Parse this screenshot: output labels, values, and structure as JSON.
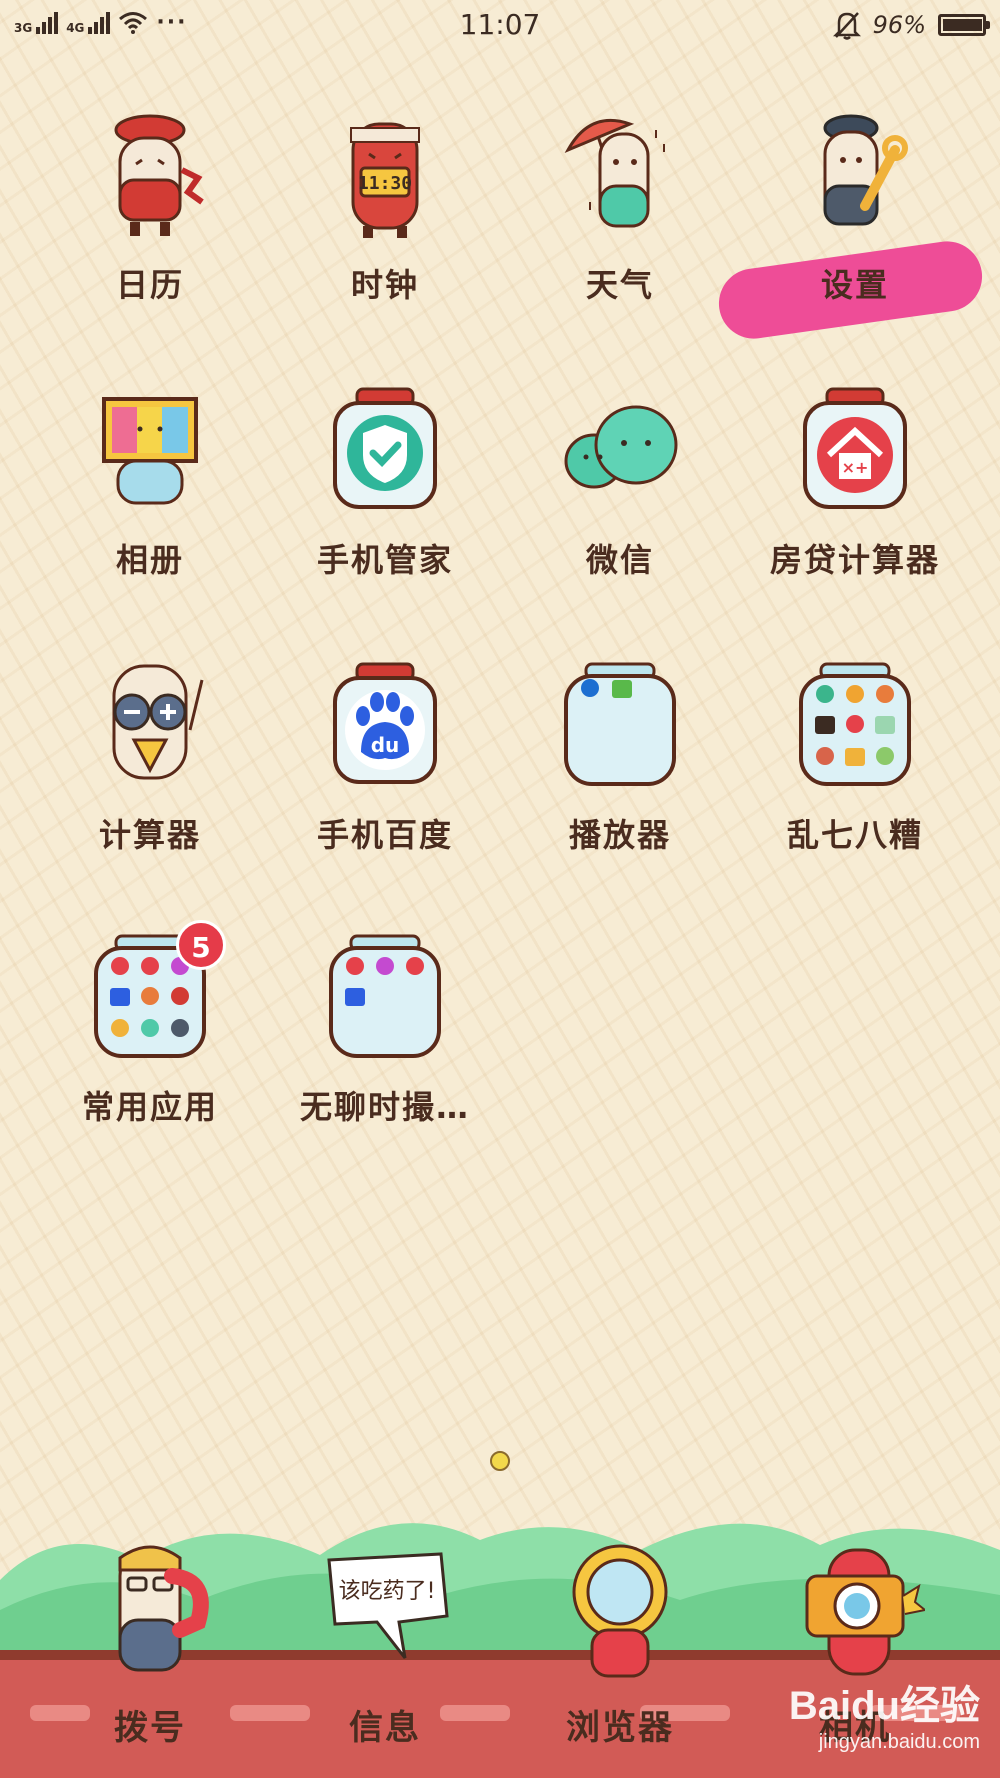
{
  "status_bar": {
    "network_1": "3G",
    "network_2": "4G",
    "time": "11:07",
    "battery_percent": "96%",
    "more": "···",
    "icons": [
      "signal-icon",
      "signal-icon",
      "wifi-icon",
      "bell-icon",
      "battery-icon"
    ]
  },
  "apps": [
    {
      "label": "日历",
      "icon": "calendar-icon"
    },
    {
      "label": "时钟",
      "icon": "clock-icon",
      "icon_text": "11:30"
    },
    {
      "label": "天气",
      "icon": "weather-icon"
    },
    {
      "label": "设置",
      "icon": "settings-icon"
    },
    {
      "label": "相册",
      "icon": "gallery-icon"
    },
    {
      "label": "手机管家",
      "icon": "phone-manager-icon"
    },
    {
      "label": "微信",
      "icon": "wechat-icon"
    },
    {
      "label": "房贷计算器",
      "icon": "mortgage-calculator-icon"
    },
    {
      "label": "计算器",
      "icon": "calculator-icon"
    },
    {
      "label": "手机百度",
      "icon": "baidu-icon",
      "icon_text": "du"
    },
    {
      "label": "播放器",
      "icon": "player-folder-icon"
    },
    {
      "label": "乱七八糟",
      "icon": "misc-folder-icon"
    },
    {
      "label": "常用应用",
      "icon": "common-apps-folder-icon",
      "badge": "5"
    },
    {
      "label": "无聊时撮…",
      "icon": "bored-folder-icon"
    }
  ],
  "dock": [
    {
      "label": "拨号",
      "icon": "dialer-icon"
    },
    {
      "label": "信息",
      "icon": "messages-icon",
      "bubble_text": "该吃药了!"
    },
    {
      "label": "浏览器",
      "icon": "browser-icon"
    },
    {
      "label": "相机",
      "icon": "camera-icon"
    }
  ],
  "watermark": {
    "logo": "Baidu经验",
    "url": "jingyan.baidu.com"
  },
  "colors": {
    "background": "#f7ecd4",
    "label": "#4a2c1f",
    "badge": "#e53b49",
    "highlight": "#ee4d97",
    "road": "#d25b56",
    "hills": "#7fd49a"
  }
}
